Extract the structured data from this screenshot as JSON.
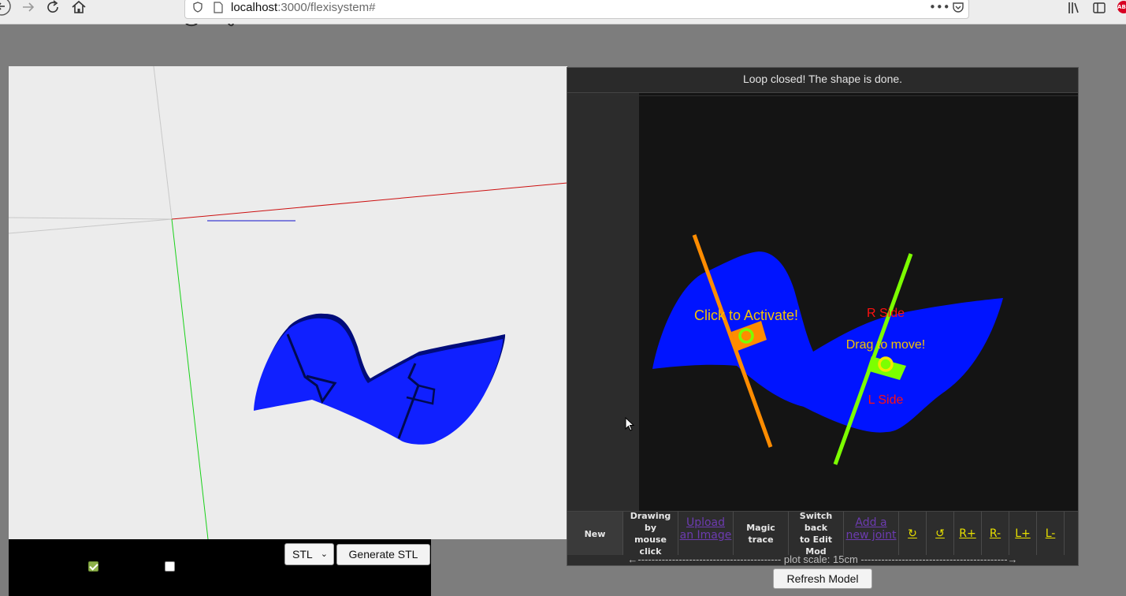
{
  "browser": {
    "url_host": "localhost",
    "url_path": ":3000/flexisystem#",
    "page_actions_glyph": "•••"
  },
  "viewer": {
    "format_select": "STL",
    "generate_button": "Generate STL",
    "checkbox1_checked": true,
    "checkbox2_checked": false
  },
  "editor": {
    "status_message": "Loop closed! The shape is done.",
    "labels": {
      "activate": "Click to Activate!",
      "drag": "Drag to move!",
      "r_side": "R Side",
      "l_side": "L Side"
    },
    "toolbar": {
      "new": "New",
      "drawing_line1": "Drawing by",
      "drawing_line2": "mouse click",
      "upload_line1": "Upload",
      "upload_line2": "an Image",
      "magic": "Magic trace",
      "switch_line1": "Switch back",
      "switch_line2": "to Edit Mod",
      "add_line1": "Add a",
      "add_line2": "new joint",
      "rotate_cw": "↻",
      "rotate_ccw": "↺",
      "r_plus": "R+",
      "r_minus": "R-",
      "l_plus": "L+",
      "l_minus": "L-"
    },
    "scale_text": "←------------------------------------------ plot scale: 15cm -------------------------------------------→",
    "refresh_button": "Refresh Model"
  },
  "colors": {
    "shape": "#0014ff",
    "joint_left": "#ff8c00",
    "joint_right": "#7cff00",
    "label_yellow": "#f5c400",
    "label_red": "#ff1010"
  }
}
